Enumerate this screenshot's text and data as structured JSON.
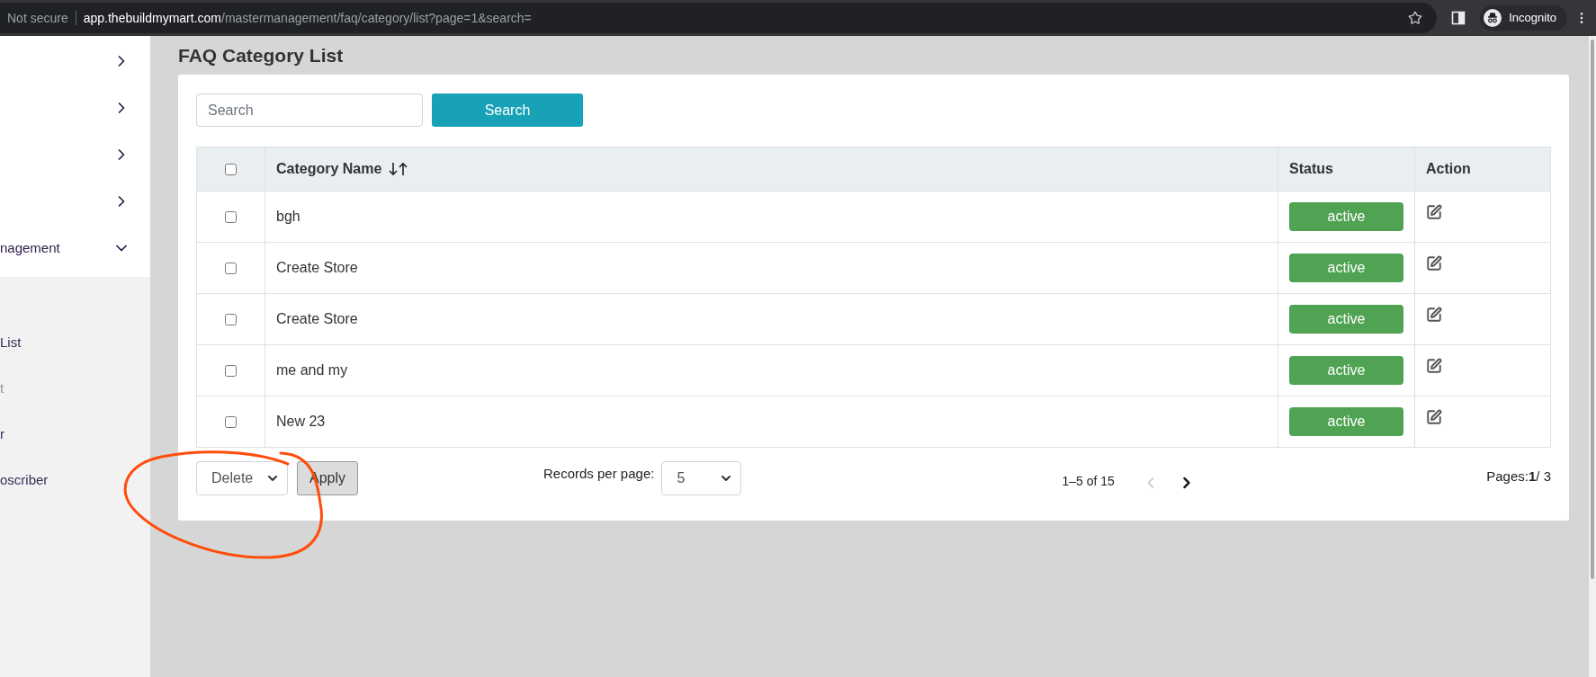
{
  "browser": {
    "security_label": "Not secure",
    "url_host": "app.thebuildmymart.com",
    "url_path": "/mastermanagement/faq/category/list?page=1&search=",
    "profile_label": "Incognito"
  },
  "sidebar": {
    "items": [
      {
        "expanded": false
      },
      {
        "expanded": false
      },
      {
        "expanded": false
      },
      {
        "expanded": false
      },
      {
        "label": "nagement",
        "expanded": true
      }
    ],
    "subitems": [
      {
        "label": "List",
        "faded": false
      },
      {
        "label": "t",
        "faded": true
      },
      {
        "label": "r",
        "faded": false
      },
      {
        "label": "oscriber",
        "faded": false
      }
    ]
  },
  "page": {
    "title": "FAQ Category List",
    "search": {
      "placeholder": "Search",
      "button": "Search"
    },
    "table": {
      "select_all_checked": false,
      "columns": [
        {
          "label": "Category Name",
          "sortable": true
        },
        {
          "label": "Status",
          "sortable": false
        },
        {
          "label": "Action",
          "sortable": false
        }
      ],
      "rows": [
        {
          "selected": false,
          "name": "bgh",
          "status": "active"
        },
        {
          "selected": false,
          "name": "Create Store",
          "status": "active"
        },
        {
          "selected": false,
          "name": "Create Store",
          "status": "active"
        },
        {
          "selected": false,
          "name": "me and my",
          "status": "active"
        },
        {
          "selected": false,
          "name": "New 23",
          "status": "active"
        }
      ]
    },
    "footer": {
      "bulk_action": "Delete",
      "apply": "Apply",
      "records_label": "Records per page:",
      "records_value": "5",
      "range": "1–5 of 15",
      "prev_disabled": true,
      "next_disabled": false,
      "pages": "Pages:**1**/ 3"
    }
  }
}
